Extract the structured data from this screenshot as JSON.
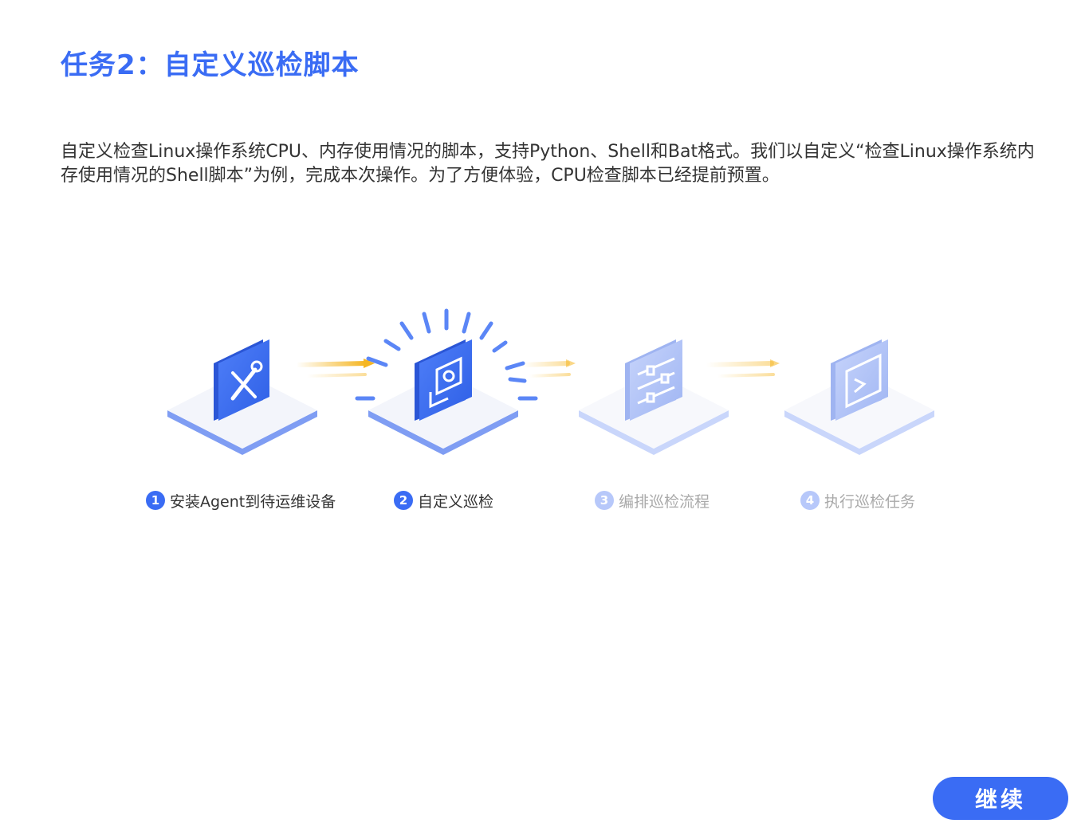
{
  "page": {
    "title": "任务2：自定义巡检脚本",
    "description": "自定义检查Linux操作系统CPU、内存使用情况的脚本，支持Python、Shell和Bat格式。我们以自定义“检查Linux操作系统内存使用情况的Shell脚本”为例，完成本次操作。为了方便体验，CPU检查脚本已经提前预置。"
  },
  "steps": [
    {
      "number": "1",
      "label": "安装Agent到待运维设备",
      "state": "active",
      "icon": "wrench-screwdriver-icon"
    },
    {
      "number": "2",
      "label": "自定义巡检",
      "state": "active",
      "icon": "custom-script-gear-icon"
    },
    {
      "number": "3",
      "label": "编排巡检流程",
      "state": "inactive",
      "icon": "sliders-icon"
    },
    {
      "number": "4",
      "label": "执行巡检任务",
      "state": "inactive",
      "icon": "terminal-icon"
    }
  ],
  "actions": {
    "continue_label": "继续"
  },
  "colors": {
    "accent": "#3a6cf4",
    "inactive": "#b7c8fa",
    "arrow": "#f5b623"
  }
}
